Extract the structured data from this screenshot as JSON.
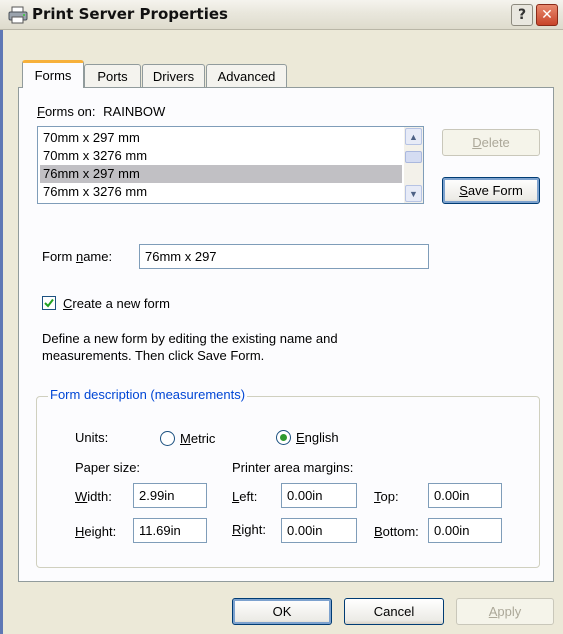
{
  "window": {
    "title": "Print Server Properties",
    "help_glyph": "?",
    "close_glyph": "✕"
  },
  "tabs": [
    {
      "label": "Forms"
    },
    {
      "label": "Ports"
    },
    {
      "label": "Drivers"
    },
    {
      "label": "Advanced"
    }
  ],
  "forms_on": {
    "prefix_u": "F",
    "label_rest": "orms on:",
    "server": "RAINBOW"
  },
  "forms_list": {
    "items": [
      "70mm x 297 mm",
      "70mm x 3276 mm",
      "76mm x 297 mm",
      "76mm x 3276 mm"
    ],
    "selected_index": 2
  },
  "buttons": {
    "delete_u": "D",
    "delete_rest": "elete",
    "save_u": "S",
    "save_rest": "ave Form",
    "ok": "OK",
    "cancel": "Cancel",
    "apply_u": "A",
    "apply_rest": "pply"
  },
  "form_name": {
    "label_pre": "Form ",
    "label_u": "n",
    "label_post": "ame:",
    "value": "76mm x 297"
  },
  "create_new": {
    "checked": true,
    "label_u": "C",
    "label_rest": "reate a new form"
  },
  "description": [
    "Define a new form by editing the existing name and",
    "measurements.  Then click Save Form."
  ],
  "group": {
    "title": "Form description (measurements)",
    "units_label": "Units:",
    "metric_u": "M",
    "metric_rest": "etric",
    "english_u": "E",
    "english_rest": "nglish",
    "selected_unit": "English",
    "paper_size_label": "Paper size:",
    "margins_label": "Printer area margins:",
    "width": {
      "label_u": "W",
      "label_rest": "idth:",
      "value": "2.99in"
    },
    "height": {
      "label_u": "H",
      "label_rest": "eight:",
      "value": "11.69in"
    },
    "left": {
      "label_u": "L",
      "label_rest": "eft:",
      "value": "0.00in"
    },
    "right": {
      "label_u": "R",
      "label_rest": "ight:",
      "value": "0.00in"
    },
    "top": {
      "label_u": "T",
      "label_rest": "op:",
      "value": "0.00in"
    },
    "bottom": {
      "label_u": "B",
      "label_rest": "ottom:",
      "value": "0.00in"
    }
  },
  "colors": {
    "accent": "#0046d5",
    "tab_highlight": "#f7b13b",
    "radio_dot": "#2f9a2f"
  }
}
